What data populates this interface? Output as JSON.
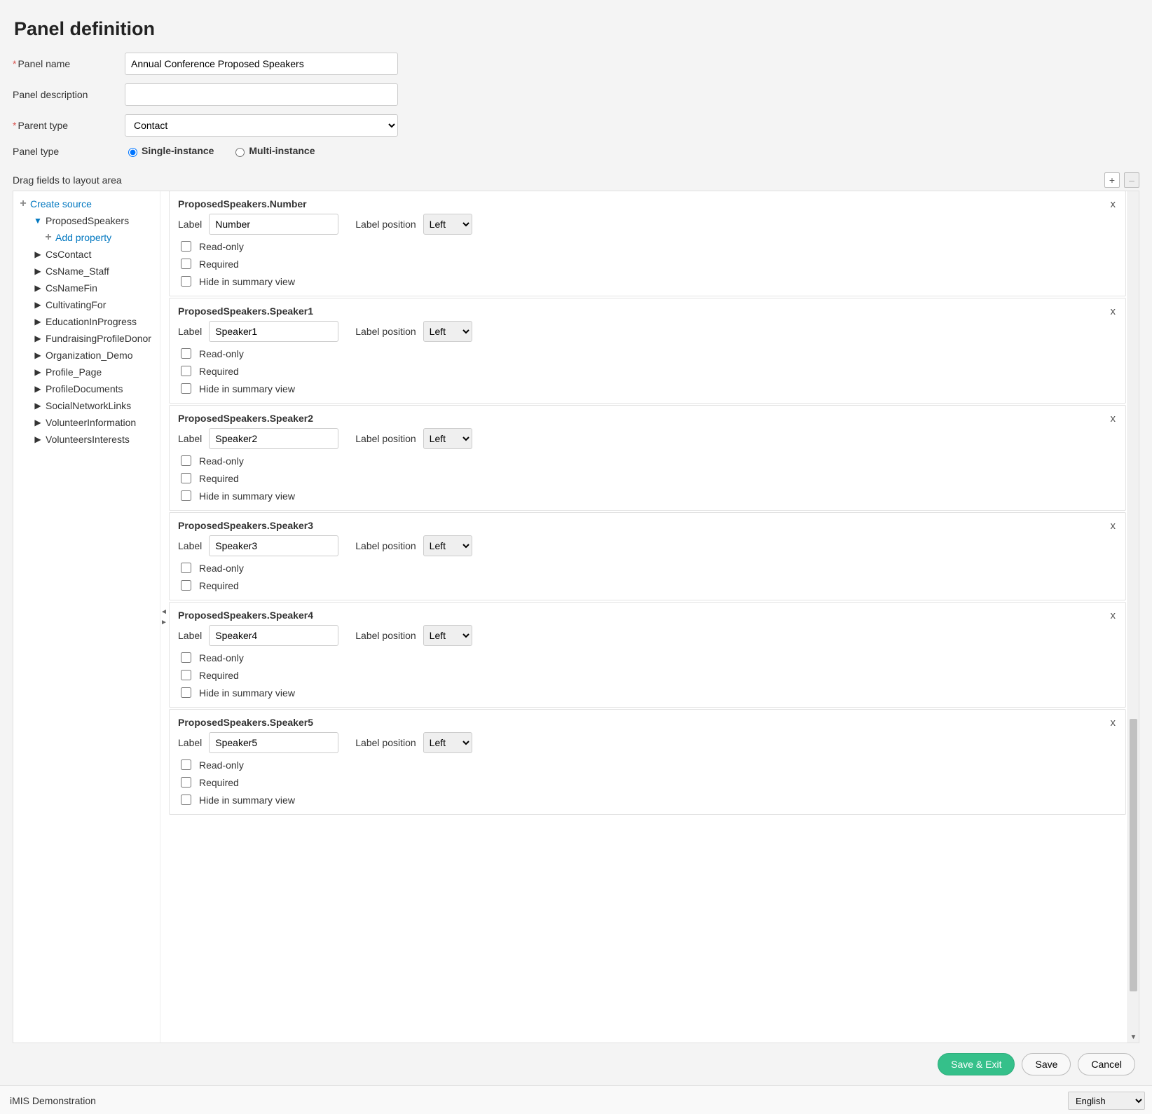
{
  "title": "Panel definition",
  "form": {
    "panel_name_label": "Panel name",
    "panel_name_value": "Annual Conference Proposed Speakers",
    "panel_desc_label": "Panel description",
    "panel_desc_value": "",
    "parent_type_label": "Parent type",
    "parent_type_value": "Contact",
    "panel_type_label": "Panel type",
    "panel_type_single": "Single-instance",
    "panel_type_multi": "Multi-instance"
  },
  "drag_label": "Drag fields to layout area",
  "tree": {
    "create_source": "Create source",
    "add_property": "Add property",
    "root": "ProposedSpeakers",
    "items": [
      "CsContact",
      "CsName_Staff",
      "CsNameFin",
      "CultivatingFor",
      "EducationInProgress",
      "FundraisingProfileDonor",
      "Organization_Demo",
      "Profile_Page",
      "ProfileDocuments",
      "SocialNetworkLinks",
      "VolunteerInformation",
      "VolunteersInterests"
    ]
  },
  "field_labels": {
    "label": "Label",
    "label_position": "Label position",
    "position_value": "Left",
    "readonly": "Read-only",
    "required": "Required",
    "hide": "Hide in summary view",
    "remove": "x"
  },
  "fields": [
    {
      "name": "ProposedSpeakers.Number",
      "label_value": "Number",
      "show_hide": true
    },
    {
      "name": "ProposedSpeakers.Speaker1",
      "label_value": "Speaker1",
      "show_hide": true
    },
    {
      "name": "ProposedSpeakers.Speaker2",
      "label_value": "Speaker2",
      "show_hide": true
    },
    {
      "name": "ProposedSpeakers.Speaker3",
      "label_value": "Speaker3",
      "show_hide": false
    },
    {
      "name": "ProposedSpeakers.Speaker4",
      "label_value": "Speaker4",
      "show_hide": true
    },
    {
      "name": "ProposedSpeakers.Speaker5",
      "label_value": "Speaker5",
      "show_hide": true
    }
  ],
  "buttons": {
    "save_exit": "Save & Exit",
    "save": "Save",
    "cancel": "Cancel"
  },
  "status": {
    "app": "iMIS Demonstration",
    "language": "English"
  }
}
